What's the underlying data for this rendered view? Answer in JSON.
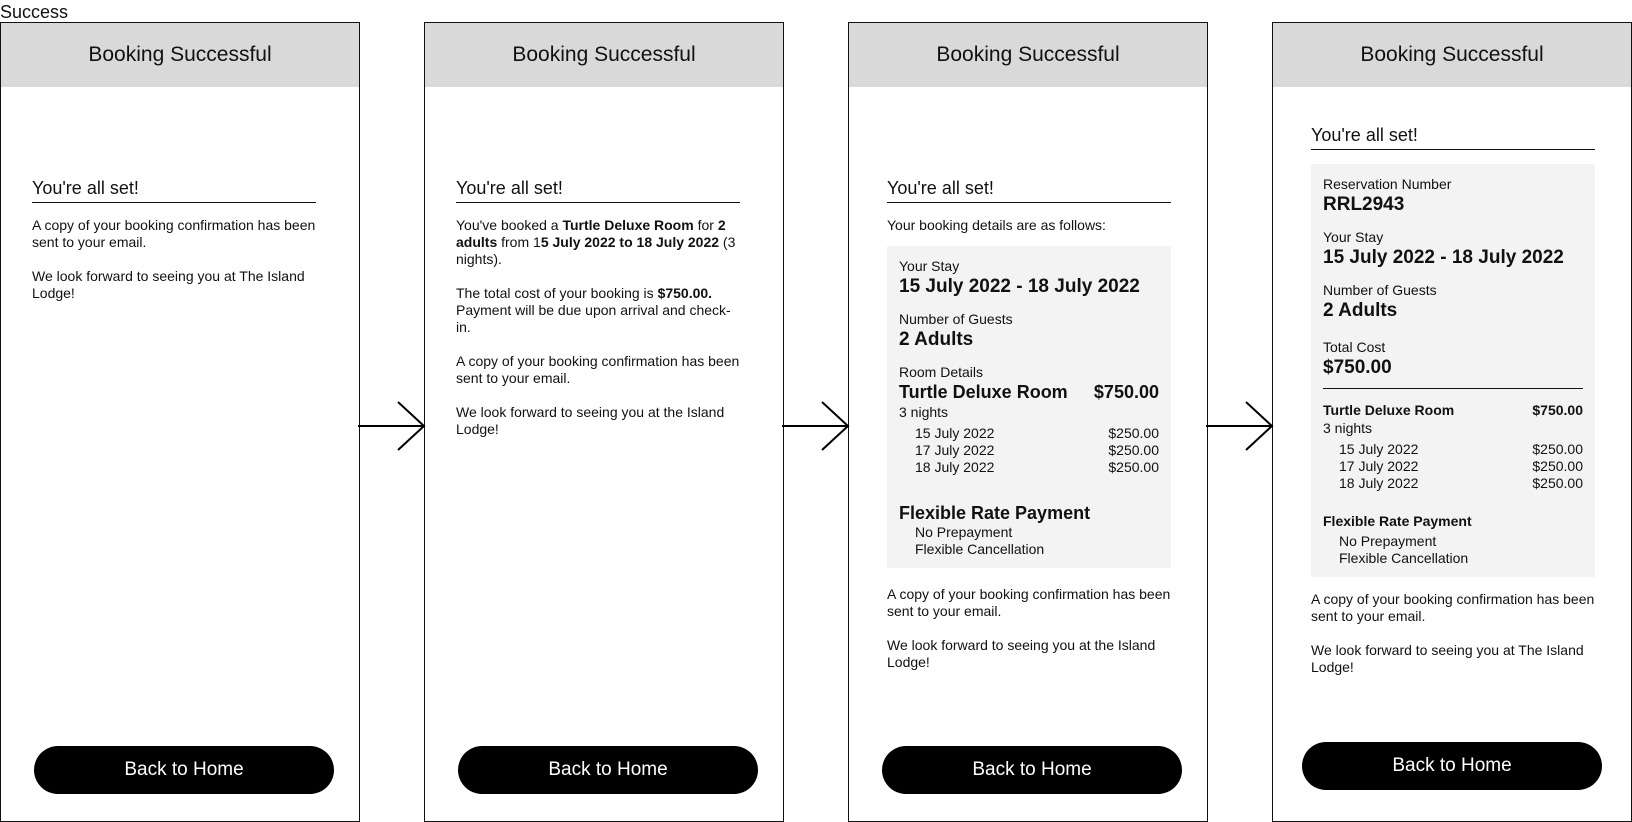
{
  "page_label": "Success",
  "header_title": "Booking Successful",
  "heading": "You're all set!",
  "back_button": "Back to Home",
  "confirmation_sent": "A copy of your booking confirmation has been sent to your email.",
  "look_forward": "We look forward to seeing you at The Island Lodge!",
  "look_forward_alt": "We look forward to seeing you at the Island Lodge!",
  "frame2": {
    "booked_prefix": "You've booked a ",
    "room_name": "Turtle Deluxe Room",
    "for_word": " for ",
    "guests_bold": "2 adults",
    "from_word": " from 1",
    "dates_bold": "5 July 2022 to 18 July 2022",
    "nights_suffix": " (3 nights).",
    "cost_prefix": "The total cost of your booking is ",
    "cost_bold": "$750.00.",
    "cost_suffix": " Payment will be due upon arrival and check-in."
  },
  "frame3": {
    "intro": "Your booking details are as follows:"
  },
  "summary": {
    "reservation_label": "Reservation Number",
    "reservation_value": "RRL2943",
    "stay_label": "Your Stay",
    "stay_value": "15 July 2022 - 18 July 2022",
    "guests_label": "Number of Guests",
    "guests_value": "2 Adults",
    "total_label": "Total Cost",
    "total_value": "$750.00",
    "room_details_label": "Room Details",
    "room_name": "Turtle Deluxe Room",
    "room_price": "$750.00",
    "nights": "3 nights",
    "night_rows": [
      {
        "date": "15 July 2022",
        "price": "$250.00"
      },
      {
        "date": "17 July 2022",
        "price": "$250.00"
      },
      {
        "date": "18 July 2022",
        "price": "$250.00"
      }
    ],
    "rate_title": "Flexible Rate Payment",
    "rate_items": [
      "No Prepayment",
      "Flexible Cancellation"
    ]
  }
}
